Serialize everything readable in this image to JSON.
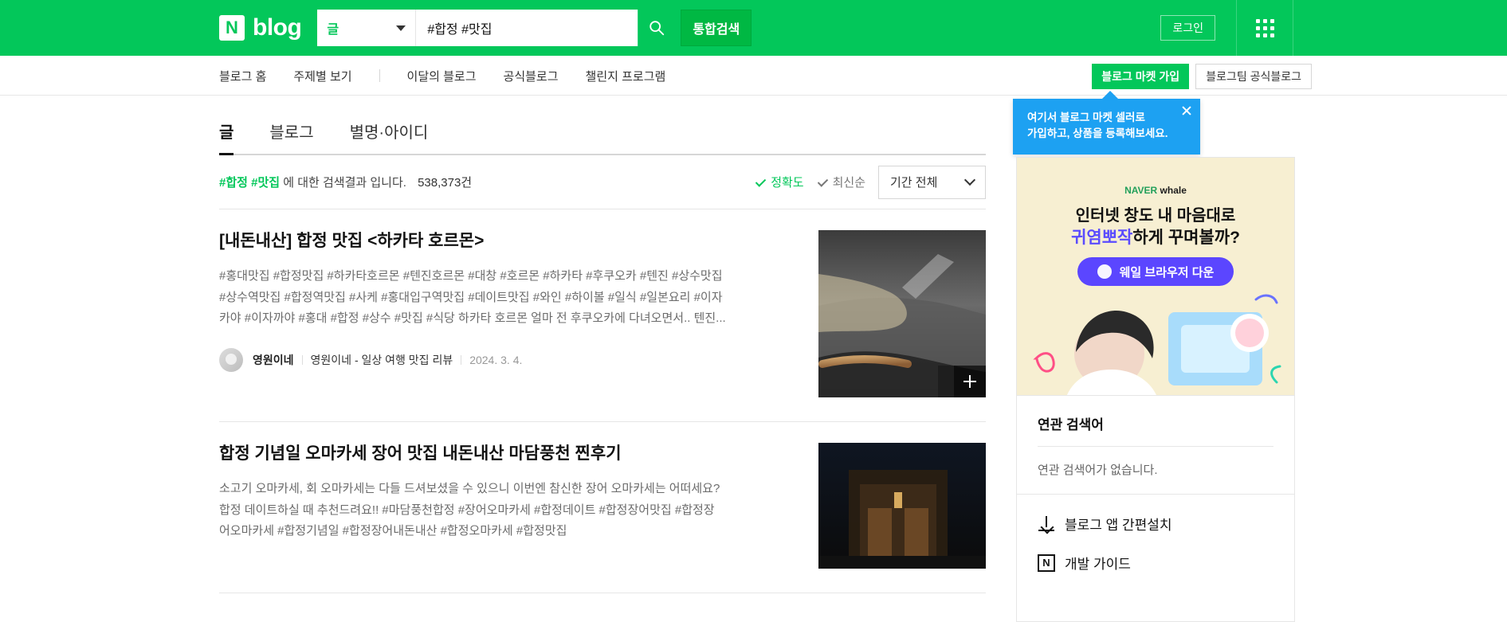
{
  "colors": {
    "accent_green": "#03c75a",
    "tooltip_blue": "#1da1f2",
    "text": "#222222"
  },
  "topbar": {
    "logo_mark": "N",
    "logo_text": "blog",
    "search_scope": "글",
    "search_query": "#합정 #맛집",
    "integrated_search_label": "통합검색",
    "login_label": "로그인",
    "apps_icon": "apps-grid-icon",
    "search_icon": "search-icon"
  },
  "subnav": {
    "items": [
      "블로그 홈",
      "주제별 보기",
      "이달의 블로그",
      "공식블로그",
      "챌린지 프로그램"
    ],
    "market_join": "블로그 마켓 가입",
    "team_official": "블로그팀 공식블로그"
  },
  "tooltip": {
    "line1": "여기서 블로그 마켓 셀러로",
    "line2": "가입하고, 상품을 등록해보세요.",
    "close_icon": "close-icon"
  },
  "tabs": [
    "글",
    "블로그",
    "별명·아이디"
  ],
  "results": {
    "tags": "#합정 #맛집",
    "desc": "에 대한 검색결과 입니다.",
    "count": "538,373건",
    "sort_accuracy": "정확도",
    "sort_latest": "최신순",
    "period": "기간 전체"
  },
  "posts": [
    {
      "title_prefix": "[내돈내산] ",
      "title_bold": "합정 맛집",
      "title_suffix": " <하카타 호르몬>",
      "snippet_lines": [
        "#홍대맛집 #합정맛집 #하카타호르몬 #텐진호르몬 #대창 #호르몬 #하카타 #후쿠오카 #텐진 #상수맛집",
        "#상수역맛집 #합정역맛집 #사케 #홍대입구역맛집 #데이트맛집 #와인 #하이볼 #일식 #일본요리 #이자",
        "카야 #이자까야 #홍대 #합정 #상수 #맛집 #식당 하카타 호르몬 얼마 전 후쿠오카에 다녀오면서.. 텐진..."
      ],
      "author": "영원이네",
      "blog": "영원이네 - 일상 여행 맛집 리뷰",
      "date": "2024. 3. 4."
    },
    {
      "title_html": "합정 기념일 오마카세 장어 맛집 내돈내산 마담풍천 찐후기",
      "snippet_lines": [
        "소고기 오마카세, 회 오마카세는 다들 드셔보셨을 수 있으니 이번엔 참신한 장어 오마카세는 어떠세요?",
        "합정 데이트하실 때 추천드려요!! #마담풍천합정 #장어오마카세 #합정데이트 #합정장어맛집 #합정장",
        "어오마카세 #합정기념일 #합정장어내돈내산 #합정오마카세 #합정맛집"
      ]
    }
  ],
  "sidebar": {
    "ad": {
      "brand_left": "NAVER",
      "brand_right": "whale",
      "line1": "인터넷 창도 내 마음대로",
      "line2_purple": "귀염뽀작",
      "line2_rest": "하게 꾸며볼까?",
      "cta": "웨일 브라우저 다운"
    },
    "related": {
      "title": "연관 검색어",
      "empty": "연관 검색어가 없습니다."
    },
    "links": [
      {
        "label": "블로그 앱 간편설치",
        "icon": "download-icon"
      },
      {
        "label": "개발 가이드",
        "icon": "n-icon"
      }
    ]
  }
}
